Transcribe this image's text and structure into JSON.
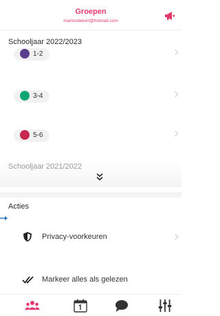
{
  "header": {
    "title": "Groepen",
    "subtitle": "mariondekort@hotmail.com",
    "accent_color": "#e2396b",
    "action_icon": "megaphone-icon"
  },
  "sections": [
    {
      "title": "Schooljaar 2022/2023",
      "groups": [
        {
          "label": "1-2",
          "color": "#5b3f8f"
        },
        {
          "label": "3-4",
          "color": "#12a571"
        },
        {
          "label": "5-6",
          "color": "#c6284f"
        }
      ]
    },
    {
      "title": "Schooljaar 2021/2022",
      "expand_icon": "double-chevron-down-icon"
    }
  ],
  "actions": {
    "title": "Acties",
    "items": [
      {
        "label": "Privacy-voorkeuren",
        "icon": "shield-icon"
      },
      {
        "label": "Markeer alles als gelezen",
        "icon": "double-check-icon"
      }
    ]
  },
  "tabbar": {
    "items": [
      {
        "icon": "groups-icon",
        "active": true
      },
      {
        "icon": "calendar-icon",
        "active": false
      },
      {
        "icon": "chat-icon",
        "active": false
      },
      {
        "icon": "settings-sliders-icon",
        "active": false
      }
    ]
  }
}
